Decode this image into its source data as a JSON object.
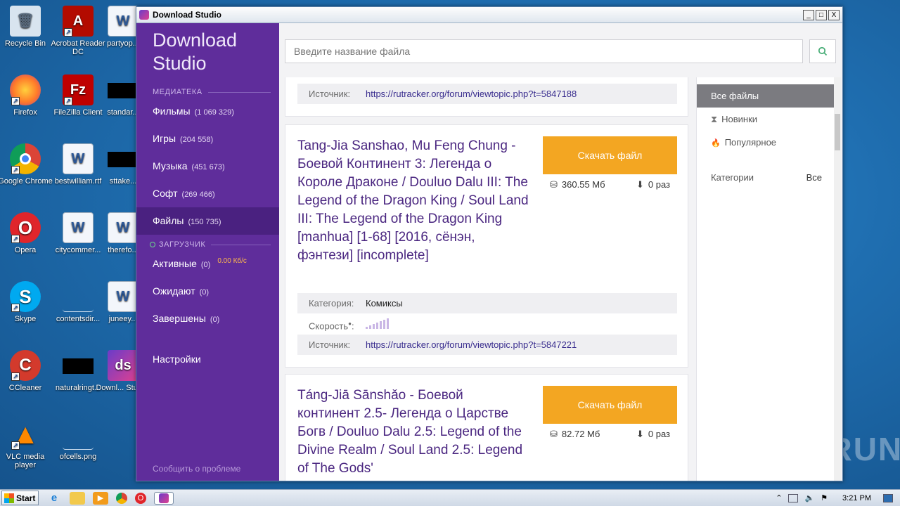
{
  "window": {
    "title": "Download Studio",
    "minimize": "_",
    "maximize": "□",
    "close": "X"
  },
  "desktop": {
    "icons": [
      {
        "label": "Recycle Bin",
        "glyph": "🗑",
        "color": "#d8e4ef"
      },
      {
        "label": "Acrobat Reader DC",
        "glyph": "A",
        "color": "#b30b00"
      },
      {
        "label": "partyop...",
        "glyph": "W",
        "color": "#f3f6fb"
      },
      {
        "label": "Firefox",
        "glyph": "",
        "color": "#ff7b2a"
      },
      {
        "label": "FileZilla Client",
        "glyph": "Fz",
        "color": "#bf0000"
      },
      {
        "label": "standar...",
        "glyph": "",
        "color": "#000000"
      },
      {
        "label": "Google Chrome",
        "glyph": "",
        "color": "#e0e0e0"
      },
      {
        "label": "bestwilliam.rtf",
        "glyph": "W",
        "color": "#f3f6fb"
      },
      {
        "label": "sttake...",
        "glyph": "",
        "color": "#000000"
      },
      {
        "label": "Opera",
        "glyph": "O",
        "color": "#e0252b"
      },
      {
        "label": "citycommer...",
        "glyph": "W",
        "color": "#f3f6fb"
      },
      {
        "label": "therefo...",
        "glyph": "W",
        "color": "#f3f6fb"
      },
      {
        "label": "Skype",
        "glyph": "S",
        "color": "#00a9f0"
      },
      {
        "label": "contentsdir...",
        "glyph": "",
        "color": "transparent"
      },
      {
        "label": "juneey...",
        "glyph": "W",
        "color": "#f3f6fb"
      },
      {
        "label": "CCleaner",
        "glyph": "C",
        "color": "#d33a2c"
      },
      {
        "label": "naturalringt...",
        "glyph": "",
        "color": "#000000"
      },
      {
        "label": "Downl... Studi...",
        "glyph": "ds",
        "color": "#7b3fd0"
      },
      {
        "label": "VLC media player",
        "glyph": "▲",
        "color": "#ff8800"
      },
      {
        "label": "ofcells.png",
        "glyph": "",
        "color": "transparent"
      }
    ]
  },
  "sidebar": {
    "brand": "Download Studio",
    "library_label": "МЕДИАТЕКА",
    "library": [
      {
        "label": "Фильмы",
        "count": "(1 069 329)"
      },
      {
        "label": "Игры",
        "count": "(204 558)"
      },
      {
        "label": "Музыка",
        "count": "(451 673)"
      },
      {
        "label": "Софт",
        "count": "(269 466)"
      },
      {
        "label": "Файлы",
        "count": "(150 735)"
      }
    ],
    "downloader_label": "ЗАГРУЗЧИК",
    "downloads": [
      {
        "label": "Активные",
        "count": "(0)",
        "speed": "0.00 Кб/с"
      },
      {
        "label": "Ожидают",
        "count": "(0)"
      },
      {
        "label": "Завершены",
        "count": "(0)"
      }
    ],
    "settings": "Настройки",
    "report": "Сообщить о проблеме"
  },
  "search": {
    "placeholder": "Введите название файла"
  },
  "results": {
    "top_partial": {
      "source_label": "Источник:",
      "source": "https://rutracker.org/forum/viewtopic.php?t=5847188"
    },
    "items": [
      {
        "title": "Tang-Jia Sanshao, Mu Feng Chung - Боевой Континент 3: Легенда о Короле Драконе / Douluo Dalu III: The Legend of the Dragon King / Soul Land III: The Legend of the Dragon King [manhua] [1-68] [2016, сёнэн, фэнтези] [incomplete]",
        "download_label": "Скачать файл",
        "size": "360.55 Мб",
        "downloads": "0 раз",
        "category_label": "Категория:",
        "category": "Комиксы",
        "speed_label": "Скорость",
        "source_label": "Источник:",
        "source": "https://rutracker.org/forum/viewtopic.php?t=5847221"
      },
      {
        "title": "Táng-Jiā Sānshǎo - Боевой континент 2.5- Легенда о Царстве Богв / Douluo Dalu 2.5: Legend of the Divine Realm / Soul Land 2.5: Legend of The Gods'",
        "download_label": "Скачать файл",
        "size": "82.72 Мб",
        "downloads": "0 раз"
      }
    ]
  },
  "filters": {
    "items": [
      {
        "label": "Все файлы",
        "icon": ""
      },
      {
        "label": "Новинки",
        "icon": "⧗"
      },
      {
        "label": "Популярное",
        "icon": "🔥"
      }
    ],
    "category_label": "Категории",
    "category_value": "Все"
  },
  "taskbar": {
    "start": "Start",
    "time": "3:21 PM"
  },
  "watermark": "ANY▷RUN"
}
